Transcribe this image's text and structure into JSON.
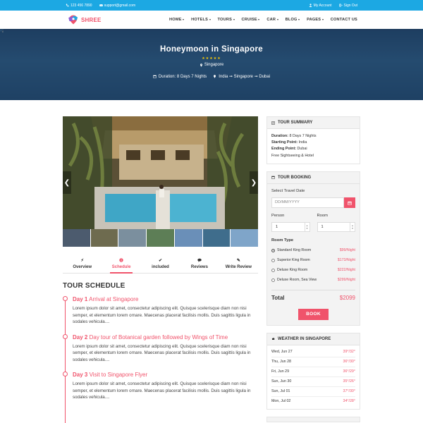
{
  "topbar": {
    "phone": "123 456 7890",
    "email": "support@gmail.com",
    "account": "My Account",
    "signout": "Sign Out"
  },
  "brand": {
    "name": "SHREE",
    "color": "#f0536b"
  },
  "nav": [
    {
      "label": "HOME",
      "caret": true
    },
    {
      "label": "HOTELS",
      "caret": true
    },
    {
      "label": "TOURS",
      "caret": true
    },
    {
      "label": "CRUISE",
      "caret": true
    },
    {
      "label": "CAR",
      "caret": true
    },
    {
      "label": "BLOG",
      "caret": true
    },
    {
      "label": "PAGES",
      "caret": true
    },
    {
      "label": "CONTACT US",
      "caret": false
    }
  ],
  "hero": {
    "title": "Honeymoon in Singapore",
    "stars": "★★★★★",
    "location": "Singapore",
    "duration": "Duration: 8 Days 7 Nights",
    "route": "India ➞ Singapore ➞ Dubai"
  },
  "tabs": [
    {
      "label": "Overview",
      "icon": "bolt-icon",
      "active": false
    },
    {
      "label": "Schedule",
      "icon": "info-icon",
      "active": true
    },
    {
      "label": "included",
      "icon": "check-icon",
      "active": false
    },
    {
      "label": "Reviews",
      "icon": "comments-icon",
      "active": false
    },
    {
      "label": "Write Review",
      "icon": "edit-icon",
      "active": false
    }
  ],
  "schedule": {
    "title": "TOUR SCHEDULE",
    "days": [
      {
        "day": "Day 1",
        "title": "Arrival at Singapore",
        "text": "Lorem ipsum dolor sit amet, consectetur adipiscing elit. Quisque scelerisque diam non nisi semper, et elementum lorem ornare. Maecenas placerat facilisis mollis. Duis sagittis ligula in sodales vehicula...."
      },
      {
        "day": "Day 2",
        "title": "Day tour of Botanical garden followed by Wings of Time",
        "text": "Lorem ipsum dolor sit amet, consectetur adipiscing elit. Quisque scelerisque diam non nisi semper, et elementum lorem ornare. Maecenas placerat facilisis mollis. Duis sagittis ligula in sodales vehicula...."
      },
      {
        "day": "Day 3",
        "title": "Visit to Singapore Flyer",
        "text": "Lorem ipsum dolor sit amet, consectetur adipiscing elit. Quisque scelerisque diam non nisi semper, et elementum lorem ornare. Maecenas placerat facilisis mollis. Duis sagittis ligula in sodales vehicula...."
      }
    ]
  },
  "summary": {
    "title": "TOUR SUMMARY",
    "duration_label": "Duration:",
    "duration": "8 Days 7 Nights",
    "start_label": "Starting Point:",
    "start": "India",
    "end_label": "Ending Point:",
    "end": "Dubai",
    "extra": "Free Sightseeing & Hotel"
  },
  "booking": {
    "title": "TOUR BOOKING",
    "date_label": "Select Travel Date",
    "date_placeholder": "DD/MM/YYYY",
    "person_label": "Person",
    "person_value": "1",
    "room_label": "Room",
    "room_value": "1",
    "room_type_label": "Room Type",
    "rooms": [
      {
        "name": "Standard King Room",
        "price": "$99/Night",
        "selected": true
      },
      {
        "name": "Superior King Room",
        "price": "$173/Night",
        "selected": false
      },
      {
        "name": "Deluxe King Room",
        "price": "$222/Night",
        "selected": false
      },
      {
        "name": "Deluxe Room, Sea View",
        "price": "$299/Night",
        "selected": false
      }
    ],
    "total_label": "Total",
    "total_value": "$2099",
    "book_label": "BOOK"
  },
  "weather": {
    "title": "WEATHER IN SINGAPORE",
    "rows": [
      {
        "day": "Wed, Jun 27",
        "temp": "39°/32°"
      },
      {
        "day": "Thu, Jun 28",
        "temp": "36°/30°"
      },
      {
        "day": "Fri, Jun 29",
        "temp": "36°/29°"
      },
      {
        "day": "Sun, Jun 30",
        "temp": "35°/26°"
      },
      {
        "day": "Sun, Jul 01",
        "temp": "37°/30°"
      },
      {
        "day": "Mon, Jul 02",
        "temp": "34°/28°"
      }
    ]
  }
}
